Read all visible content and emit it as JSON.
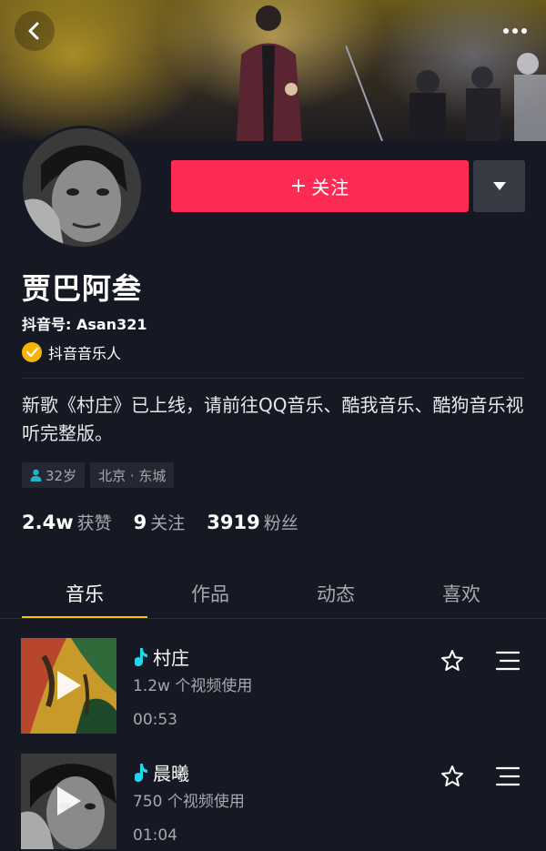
{
  "header": {
    "back_icon": "chevron-left-icon",
    "more_icon": "ellipsis-icon"
  },
  "profile": {
    "follow_label": "关注",
    "name": "贾巴阿叁",
    "douyin_id": "抖音号: Asan321",
    "badge_label": "抖音音乐人",
    "bio": "新歌《村庄》已上线，请前往QQ音乐、酷我音乐、酷狗音乐视听完整版。",
    "tags": [
      "32岁",
      "北京 · 东城"
    ],
    "stats": [
      {
        "num": "2.4w",
        "label": "获赞"
      },
      {
        "num": "9",
        "label": "关注"
      },
      {
        "num": "3919",
        "label": "粉丝"
      }
    ]
  },
  "tabs": [
    {
      "label": "音乐",
      "active": true
    },
    {
      "label": "作品",
      "active": false
    },
    {
      "label": "动态",
      "active": false
    },
    {
      "label": "喜欢",
      "active": false
    }
  ],
  "tracks": [
    {
      "title": "村庄",
      "usage": "1.2w 个视频使用",
      "duration": "00:53"
    },
    {
      "title": "晨曦",
      "usage": "750 个视频使用",
      "duration": "01:04"
    }
  ],
  "colors": {
    "background": "#161823",
    "accent": "#fe2c55",
    "tab_indicator": "#f7c400",
    "badge": "#f7b500",
    "note": "#20d5ec"
  }
}
